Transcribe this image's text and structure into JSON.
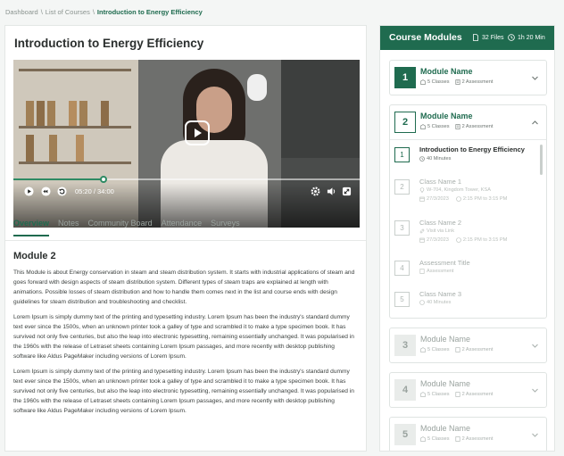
{
  "breadcrumb": {
    "items": [
      "Dashboard",
      "List of Courses"
    ],
    "current": "Introduction to Energy Efficiency",
    "separator": "\\"
  },
  "page": {
    "title": "Introduction to Energy Efficiency"
  },
  "player": {
    "time": "05:20 / 34:00",
    "progress_fraction": 0.26
  },
  "tabs": [
    {
      "label": "Overview",
      "active": true
    },
    {
      "label": "Notes",
      "active": false
    },
    {
      "label": "Community Board",
      "active": false
    },
    {
      "label": "Attendance",
      "active": false
    },
    {
      "label": "Surveys",
      "active": false
    }
  ],
  "content": {
    "section_title": "Module 2",
    "paragraphs": [
      "This Module is about Energy conservation in steam and steam distribution system. It starts with industrial applications of steam and goes forward with design aspects of steam distribution system. Different types of steam traps are explained at length with animations. Possible losses of steam distribution and how to handle them comes next in the list and course ends with design guidelines for steam distribution and troubleshooting and checklist.",
      "Lorem Ipsum is simply dummy text of the printing and typesetting industry. Lorem Ipsum has been the industry's standard dummy text ever since the 1500s, when an unknown printer took a galley of type and scrambled it to make a type specimen book. It has survived not only five centuries, but also the leap into electronic typesetting, remaining essentially unchanged. It was popularised in the 1960s with the release of Letraset sheets containing Lorem Ipsum passages, and more recently with desktop publishing software like Aldus PageMaker including versions of Lorem Ipsum.",
      "Lorem Ipsum is simply dummy text of the printing and typesetting industry. Lorem Ipsum has been the industry's standard dummy text ever since the 1500s, when an unknown printer took a galley of type and scrambled it to make a type specimen book. It has survived not only five centuries, but also the leap into electronic typesetting, remaining essentially unchanged. It was popularised in the 1960s with the release of Letraset sheets containing Lorem Ipsum passages, and more recently with desktop publishing software like Aldus PageMaker including versions of Lorem Ipsum."
    ]
  },
  "sidebar": {
    "title": "Course Modules",
    "files": "32 Files",
    "duration": "1h 20 Min",
    "modules": [
      {
        "num": "1",
        "name": "Module Name",
        "classes": "5 Classes",
        "assessment": "2 Assessment"
      },
      {
        "num": "2",
        "name": "Module Name",
        "classes": "5 Classes",
        "assessment": "2 Assessment"
      },
      {
        "num": "3",
        "name": "Module Name",
        "classes": "5 Classes",
        "assessment": "2 Assessment"
      },
      {
        "num": "4",
        "name": "Module Name",
        "classes": "5 Classes",
        "assessment": "2 Assessment"
      },
      {
        "num": "5",
        "name": "Module Name",
        "classes": "5 Classes",
        "assessment": "2 Assessment"
      }
    ],
    "lessons": [
      {
        "num": "1",
        "name": "Introduction to Energy Efficiency",
        "meta1": "40 Minutes"
      },
      {
        "num": "2",
        "name": "Class Name 1",
        "meta1": "W-704, Kingdom Tower, KSA",
        "date": "27/3/2023",
        "time": "2:15 PM to 3:15 PM"
      },
      {
        "num": "3",
        "name": "Class Name 2",
        "meta1": "Visit via Link",
        "date": "27/3/2023",
        "time": "2:15 PM to 3:15 PM"
      },
      {
        "num": "4",
        "name": "Assessment Title",
        "meta1": "Assessment"
      },
      {
        "num": "5",
        "name": "Class Name 3",
        "meta1": "40 Minutes"
      }
    ]
  },
  "colors": {
    "brand": "#1f6b4f"
  }
}
